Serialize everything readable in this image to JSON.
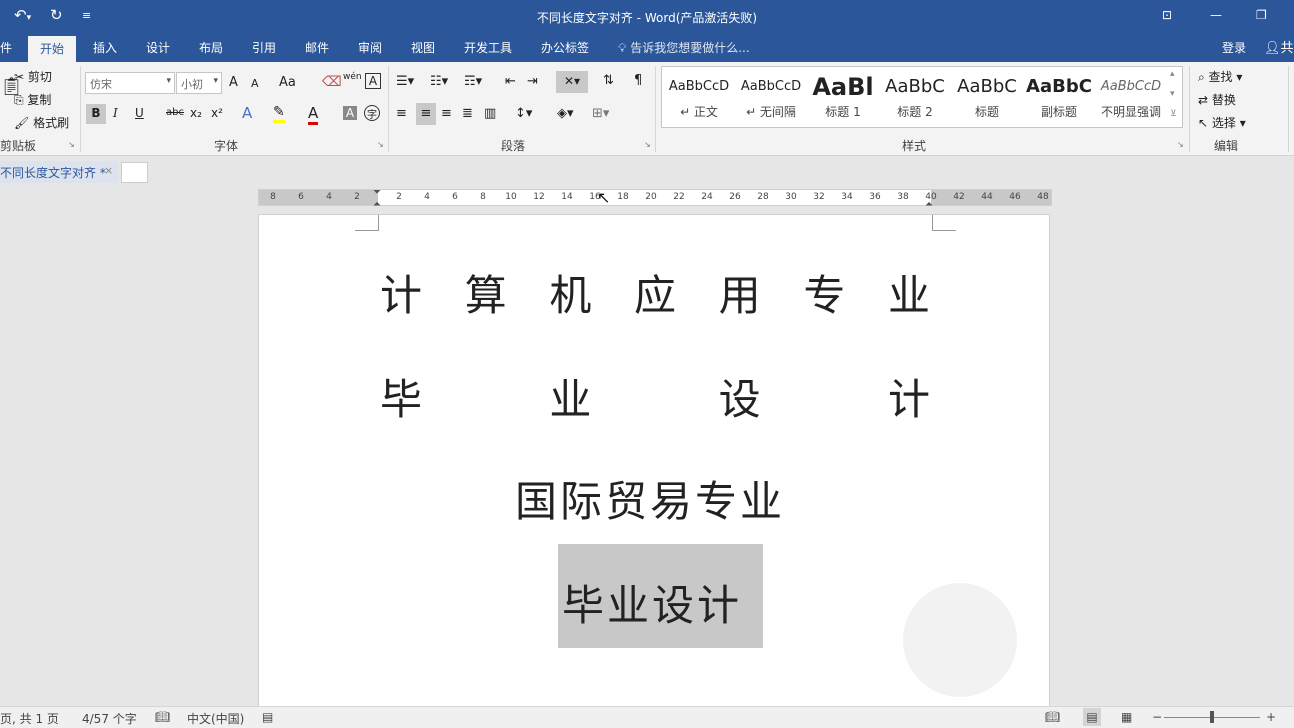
{
  "title_bar": {
    "title": "不同长度文字对齐 - Word(产品激活失败)",
    "undo_icon": "undo-icon",
    "redo_icon": "redo-icon",
    "customize_icon": "customize-quick-access-icon",
    "window_icons": [
      "ribbon-display-icon",
      "minimize-icon",
      "restore-icon"
    ]
  },
  "ribbon_tabs": [
    {
      "label": "件"
    },
    {
      "label": "开始"
    },
    {
      "label": "插入"
    },
    {
      "label": "设计"
    },
    {
      "label": "布局"
    },
    {
      "label": "引用"
    },
    {
      "label": "邮件"
    },
    {
      "label": "审阅"
    },
    {
      "label": "视图"
    },
    {
      "label": "开发工具"
    },
    {
      "label": "办公标签"
    }
  ],
  "tell_me": "告诉我您想要做什么...",
  "login": "登录",
  "share": "共",
  "clipboard": {
    "cut": "剪切",
    "copy": "复制",
    "format_painter": "格式刷",
    "group_label": "剪贴板"
  },
  "font_group": {
    "font_name": "仿宋",
    "font_size": "小初",
    "grow": "A",
    "shrink": "A",
    "change_case": "Aa",
    "phonetic": "wén",
    "bold": "B",
    "italic": "I",
    "underline": "U",
    "strikethrough": "abc",
    "subscript": "x₂",
    "superscript": "x²",
    "group_label": "字体"
  },
  "paragraph_group": {
    "group_label": "段落"
  },
  "styles_group": {
    "group_label": "样式",
    "items": [
      {
        "preview": "AaBbCcD",
        "name": "↵ 正文"
      },
      {
        "preview": "AaBbCcD",
        "name": "↵ 无间隔"
      },
      {
        "preview": "AaBl",
        "name": "标题 1"
      },
      {
        "preview": "AaBbC",
        "name": "标题 2"
      },
      {
        "preview": "AaBbC",
        "name": "标题"
      },
      {
        "preview": "AaBbC",
        "name": "副标题"
      },
      {
        "preview": "AaBbCcD",
        "name": "不明显强调"
      }
    ]
  },
  "editing_group": {
    "find": "查找",
    "replace": "替换",
    "select": "选择",
    "group_label": "编辑"
  },
  "document_tab": {
    "label": "不同长度文字对齐 *",
    "close": "×"
  },
  "ruler": {
    "left_labels": [
      "8",
      "6",
      "4",
      "2"
    ],
    "right_labels": [
      "2",
      "4",
      "6",
      "8",
      "10",
      "12",
      "14",
      "16",
      "18",
      "20",
      "22",
      "24",
      "26",
      "28",
      "30",
      "32",
      "34",
      "36",
      "38",
      "40",
      "42",
      "44",
      "46",
      "48"
    ]
  },
  "document": {
    "line1": [
      "计",
      "算",
      "机",
      "应",
      "用",
      "专",
      "业"
    ],
    "line2": [
      "毕",
      "业",
      "设",
      "计"
    ],
    "line3": "国际贸易专业",
    "line4": "毕业设计"
  },
  "status_bar": {
    "page": "页, 共 1 页",
    "words": "4/57 个字",
    "language": "中文(中国)"
  }
}
